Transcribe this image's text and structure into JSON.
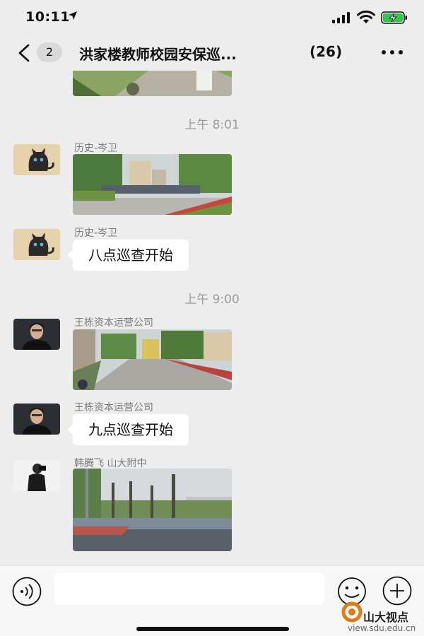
{
  "status_bar": {
    "time": "10:11",
    "icons": [
      "location-arrow-icon",
      "signal-icon",
      "wifi-icon",
      "battery-charging-icon"
    ],
    "battery_color": "#33c74b"
  },
  "header": {
    "back_badge": "2",
    "title": "洪家楼教师校园安保巡...",
    "member_count": "(26)",
    "icons": [
      "back-chevron-icon",
      "more-dots-icon"
    ]
  },
  "messages": {
    "timestamps": [
      "上午 8:01",
      "上午 9:00"
    ],
    "items": [
      {
        "sender": "",
        "kind": "photo",
        "scene": "path-with-trees"
      },
      {
        "sender": "历史-岑卫",
        "kind": "photo",
        "scene": "school-gate",
        "avatar": "black-cat"
      },
      {
        "sender": "历史-岑卫",
        "kind": "text",
        "text": "八点巡查开始",
        "avatar": "black-cat"
      },
      {
        "sender": "王栋资本运营公司",
        "kind": "photo",
        "scene": "campus-road",
        "avatar": "man-portrait"
      },
      {
        "sender": "王栋资本运营公司",
        "kind": "text",
        "text": "九点巡查开始",
        "avatar": "man-portrait"
      },
      {
        "sender": "韩腾飞 山大附中",
        "kind": "photo",
        "scene": "playground",
        "avatar": "man-photographer"
      }
    ]
  },
  "input_bar": {
    "placeholder": "",
    "icons": [
      "voice-icon",
      "emoji-icon",
      "plus-icon"
    ]
  },
  "watermark": {
    "name": "山大视点",
    "url": "view.sdu.edu.cn"
  },
  "colors": {
    "background": "#ededed",
    "bubble": "#ffffff",
    "timestamp": "#9a9a9a",
    "sender": "#7a7a7a"
  }
}
